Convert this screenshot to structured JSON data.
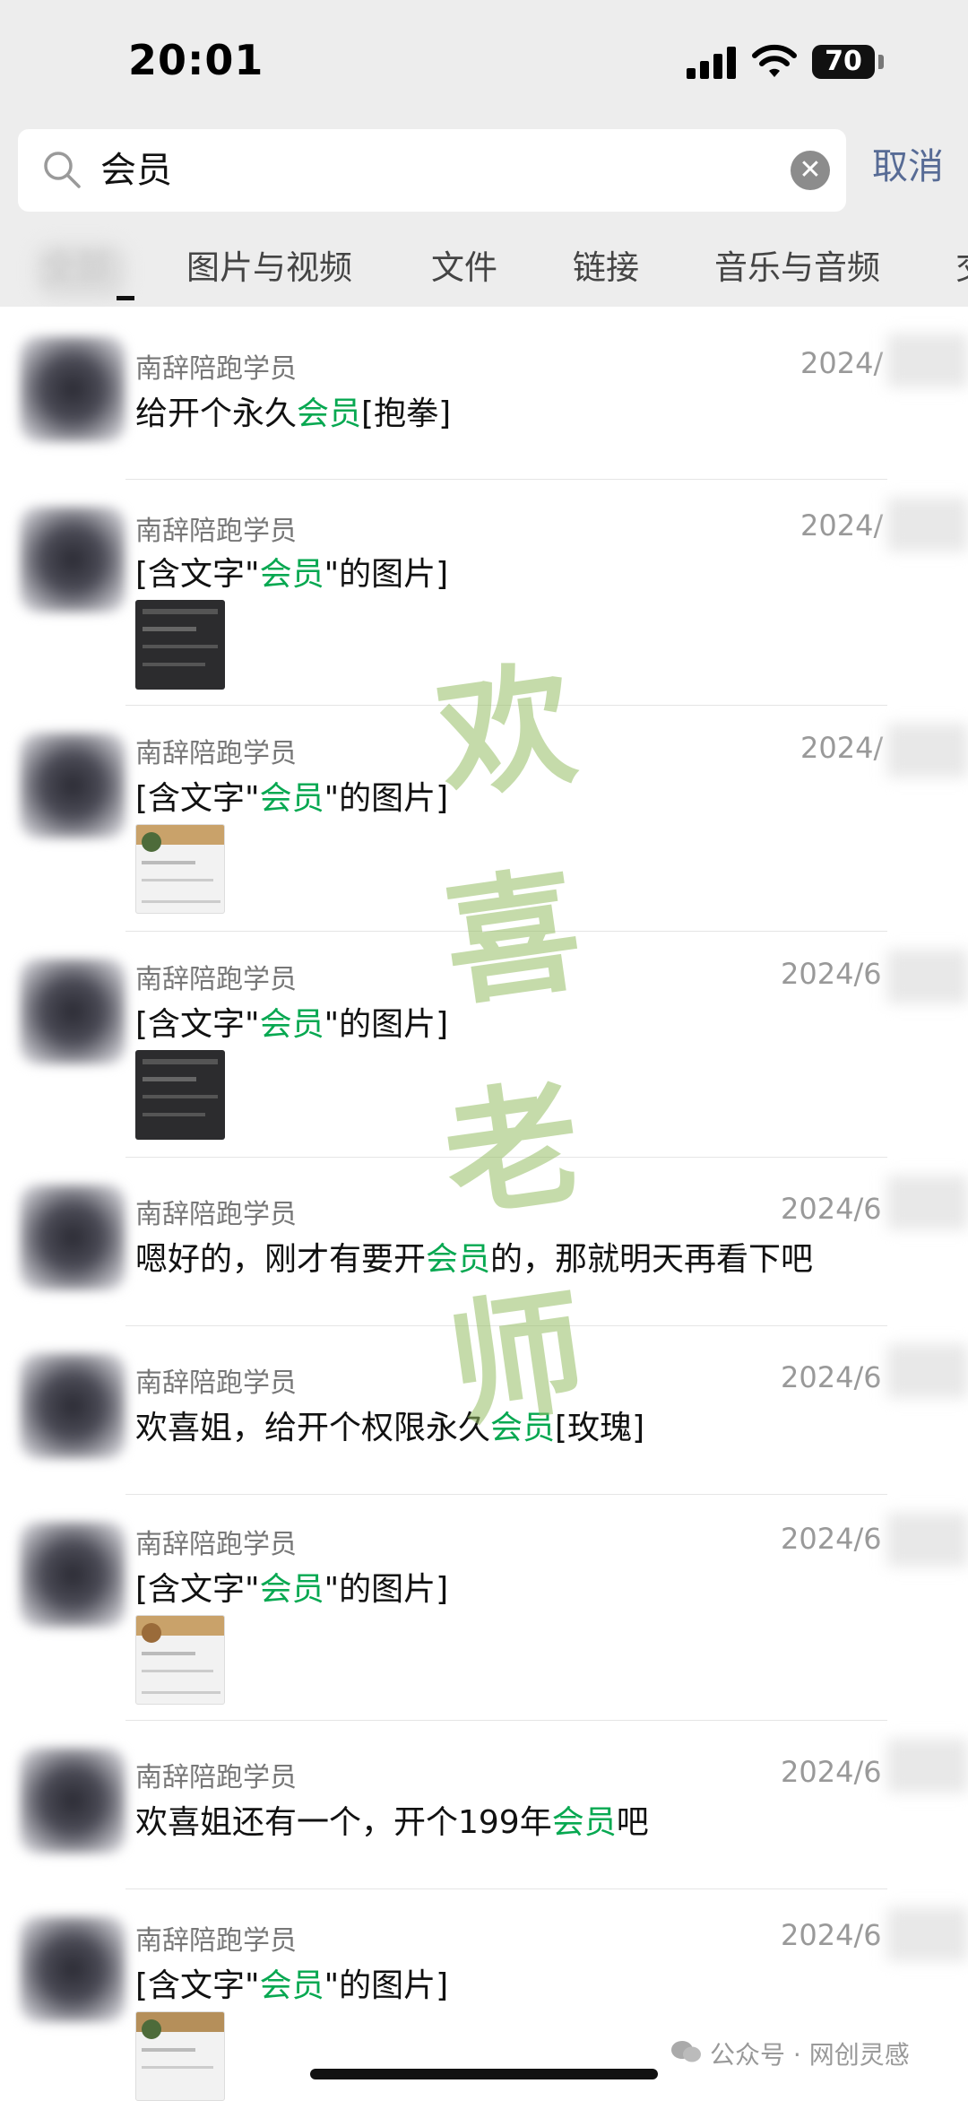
{
  "status_bar": {
    "time": "20:01",
    "battery": "70"
  },
  "search": {
    "query": "会员",
    "cancel_label": "取消"
  },
  "tabs": [
    {
      "label": "全部"
    },
    {
      "label": "图片与视频"
    },
    {
      "label": "文件"
    },
    {
      "label": "链接"
    },
    {
      "label": "音乐与音频"
    },
    {
      "label": "交"
    }
  ],
  "results": [
    {
      "sender": "南辞陪跑学员",
      "date": "2024/",
      "pre": "给开个永久",
      "hl": "会员",
      "post": "[抱拳]"
    },
    {
      "sender": "南辞陪跑学员",
      "date": "2024/",
      "pre": "[含文字\"",
      "hl": "会员",
      "post": "\"的图片]"
    },
    {
      "sender": "南辞陪跑学员",
      "date": "2024/",
      "pre": "[含文字\"",
      "hl": "会员",
      "post": "\"的图片]"
    },
    {
      "sender": "南辞陪跑学员",
      "date": "2024/6",
      "pre": "[含文字\"",
      "hl": "会员",
      "post": "\"的图片]"
    },
    {
      "sender": "南辞陪跑学员",
      "date": "2024/6",
      "pre": "嗯好的，刚才有要开",
      "hl": "会员",
      "post": "的，那就明天再看下吧"
    },
    {
      "sender": "南辞陪跑学员",
      "date": "2024/6",
      "pre": "欢喜姐，给开个权限永久",
      "hl": "会员",
      "post": "[玫瑰]"
    },
    {
      "sender": "南辞陪跑学员",
      "date": "2024/6",
      "pre": "[含文字\"",
      "hl": "会员",
      "post": "\"的图片]"
    },
    {
      "sender": "南辞陪跑学员",
      "date": "2024/6",
      "pre": "欢喜姐还有一个，开个199年",
      "hl": "会员",
      "post": "吧"
    },
    {
      "sender": "南辞陪跑学员",
      "date": "2024/6",
      "pre": "[含文字\"",
      "hl": "会员",
      "post": "\"的图片]"
    }
  ],
  "watermark": [
    "欢",
    "喜",
    "老",
    "师"
  ],
  "footer": {
    "credit": "公众号 · 网创灵感"
  }
}
